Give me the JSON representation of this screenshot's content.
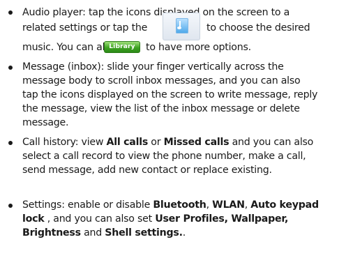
{
  "items": [
    {
      "lines": [
        [
          "Audio player: tap the icons displayed on the screen to a"
        ],
        [
          "related settings or tap the"
        ],
        [
          "to choose the desired"
        ],
        [
          "music. You can also tap"
        ],
        [
          "to have more options."
        ]
      ]
    },
    {
      "lines": [
        "Message (inbox): slide your finger vertically across the",
        "message body to scroll inbox messages, and you can also",
        "tap the icons displayed on the screen to write message, reply",
        "the message, view the list of the inbox message or delete",
        "message."
      ]
    },
    {
      "l1a": "Call history: view ",
      "l1b": "All calls",
      "l1c": " or ",
      "l1d": "Missed calls",
      "l1e": " and you can also",
      "l2": "select a call record to view the phone number, make a call,",
      "l3": "send message, add new contact or replace existing."
    },
    {
      "l1a": "Settings: enable or disable ",
      "l1b": "Bluetooth",
      "l1c": ", ",
      "l1d": "WLAN",
      "l1e": ", ",
      "l1f": "Auto keypad",
      "l2a": "lock",
      "l2b": " , and you can also set ",
      "l2c": "User Profiles, Wallpaper,",
      "l3a": "Brightness",
      "l3b": " and ",
      "l3c": "Shell settings.",
      "l3d": "."
    }
  ],
  "library_button_label": "Library"
}
